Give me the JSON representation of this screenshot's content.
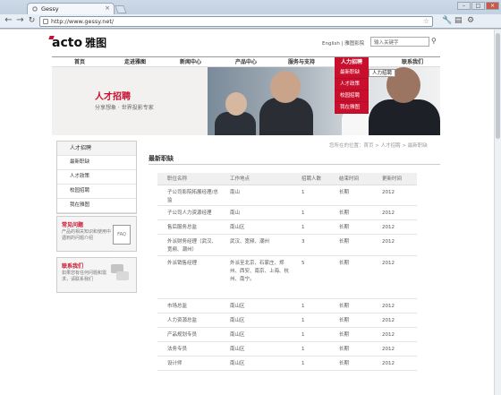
{
  "browser": {
    "tab_title": "Gessy",
    "url": "http://www.gessy.net/",
    "tab_close": "×",
    "win_min": "–",
    "win_max": "□",
    "win_close": "×"
  },
  "header": {
    "logo_text": "acto",
    "logo_cn": "雅图",
    "top_links": "English | 雅图影院",
    "search_placeholder": "输入关键字"
  },
  "menu": [
    {
      "label": "首页"
    },
    {
      "label": "走进雅图"
    },
    {
      "label": "新闻中心"
    },
    {
      "label": "产品中心"
    },
    {
      "label": "服务与支持"
    },
    {
      "label": "人力招聘"
    },
    {
      "label": "联系我们"
    }
  ],
  "dropdown": [
    {
      "label": "最新职缺"
    },
    {
      "label": "人才政策"
    },
    {
      "label": "校园招聘"
    },
    {
      "label": "我在雅图"
    }
  ],
  "tooltip": "人力招聘",
  "banner": {
    "title": "人才招聘",
    "subtitle": "分享想象 · 世界投影专家"
  },
  "sidebar": {
    "items": [
      {
        "label": "人才招聘"
      },
      {
        "label": "最新职缺"
      },
      {
        "label": "人才政策"
      },
      {
        "label": "校园招聘"
      },
      {
        "label": "我在雅图"
      }
    ],
    "faq": {
      "title": "常见问题",
      "text": "产品的相关知识和使用中遇到的问题介绍",
      "icon_label": "FAQ"
    },
    "contact": {
      "title": "联系我们",
      "text": "如果您有任何问题和需求，请联系我们"
    }
  },
  "main": {
    "breadcrumb": "您所在的位置：首页 > 人才招聘 > 最新职缺",
    "title": "最新职缺",
    "columns": [
      "职位名称",
      "工作地点",
      "招聘人数",
      "结束时间",
      "更新时间"
    ],
    "rows": [
      [
        "子公司影院拓展经理/总监",
        "南山",
        "1",
        "长期",
        "2012"
      ],
      [
        "子公司人力资源经理",
        "南山",
        "1",
        "长期",
        "2012"
      ],
      [
        "售后服务总监",
        "南山区",
        "1",
        "长期",
        "2012"
      ],
      [
        "外派财务经理（武汉、宽频、潮州）",
        "武汉、宽频、潮州",
        "3",
        "长期",
        "2012"
      ],
      [
        "外派销售经理",
        "外派至北京、石家庄、郑州、西安、南京、上海、杭州、南宁。",
        "5",
        "长期",
        "2012"
      ],
      [
        "市场总监",
        "南山区",
        "1",
        "长期",
        "2012"
      ],
      [
        "人力资源总监",
        "南山区",
        "1",
        "长期",
        "2012"
      ],
      [
        "产品规划专员",
        "南山区",
        "1",
        "长期",
        "2012"
      ],
      [
        "法务专员",
        "南山区",
        "1",
        "长期",
        "2012"
      ],
      [
        "设计师",
        "南山区",
        "1",
        "长期",
        "2012"
      ]
    ]
  }
}
